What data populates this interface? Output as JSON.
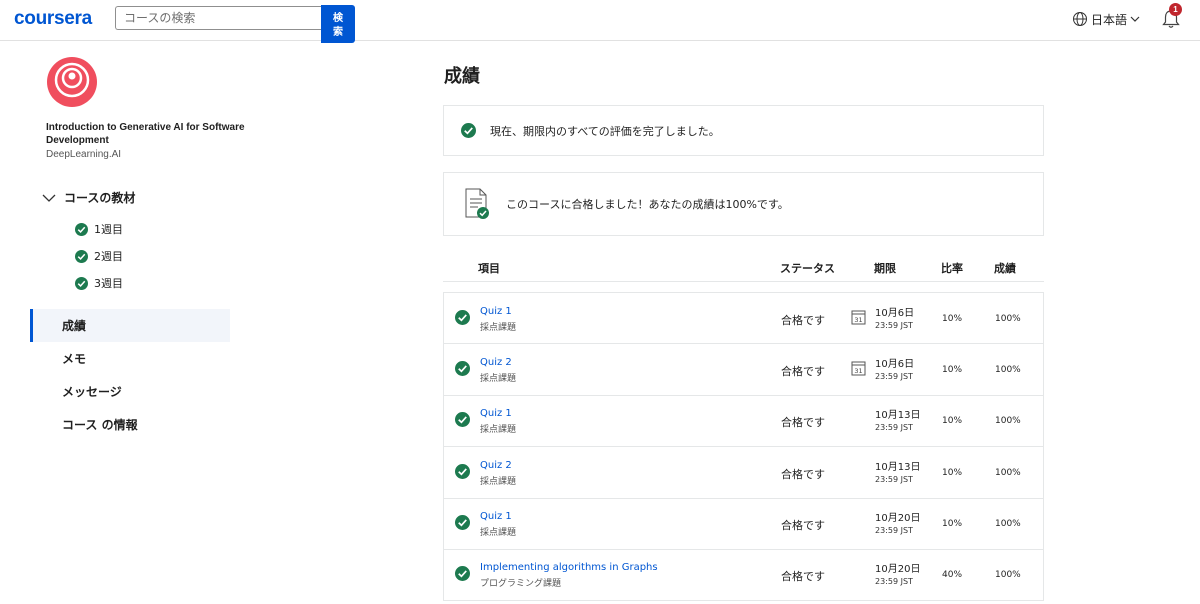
{
  "header": {
    "logo": "coursera",
    "search_placeholder": "コースの検索",
    "search_button": "検\n索",
    "language": "日本語",
    "notification_count": "1"
  },
  "sidebar": {
    "course_title": "Introduction to Generative AI for Software Development",
    "course_org": "DeepLearning.AI",
    "materials_label": "コースの教材",
    "weeks": [
      {
        "label": "1週目"
      },
      {
        "label": "2週目"
      },
      {
        "label": "3週目"
      }
    ],
    "nav": [
      {
        "label": "成績",
        "active": true
      },
      {
        "label": "メモ"
      },
      {
        "label": "メッセージ"
      },
      {
        "label": "コース の情報"
      }
    ]
  },
  "main": {
    "title": "成績",
    "notice_complete": "現在、期限内のすべての評価を完了しました。",
    "notice_passed": "このコースに合格しました！あなたの成績は100%です。",
    "table": {
      "headers": {
        "item": "項目",
        "status": "ステータス",
        "due": "期限",
        "weight": "比率",
        "grade": "成績"
      },
      "rows": [
        {
          "name": "Quiz 1",
          "type": "採点課題",
          "status": "合格です",
          "date": "10月6日",
          "time": "23:59 JST",
          "weight": "10%",
          "grade": "100%",
          "calendar": true
        },
        {
          "name": "Quiz 2",
          "type": "採点課題",
          "status": "合格です",
          "date": "10月6日",
          "time": "23:59 JST",
          "weight": "10%",
          "grade": "100%",
          "calendar": true
        },
        {
          "name": "Quiz 1",
          "type": "採点課題",
          "status": "合格です",
          "date": "10月13日",
          "time": "23:59 JST",
          "weight": "10%",
          "grade": "100%",
          "calendar": false
        },
        {
          "name": "Quiz 2",
          "type": "採点課題",
          "status": "合格です",
          "date": "10月13日",
          "time": "23:59 JST",
          "weight": "10%",
          "grade": "100%",
          "calendar": false
        },
        {
          "name": "Quiz 1",
          "type": "採点課題",
          "status": "合格です",
          "date": "10月20日",
          "time": "23:59 JST",
          "weight": "10%",
          "grade": "100%",
          "calendar": false
        },
        {
          "name": "Implementing algorithms in Graphs",
          "type": "プログラミング課題",
          "status": "合格です",
          "date": "10月20日",
          "time": "23:59 JST",
          "weight": "40%",
          "grade": "100%",
          "calendar": false
        }
      ]
    },
    "calendar_day": "31"
  },
  "colors": {
    "brand": "#0056d2",
    "success": "#1d7a4f",
    "badge": "#c0262d",
    "logo_red": "#f04e5e"
  }
}
